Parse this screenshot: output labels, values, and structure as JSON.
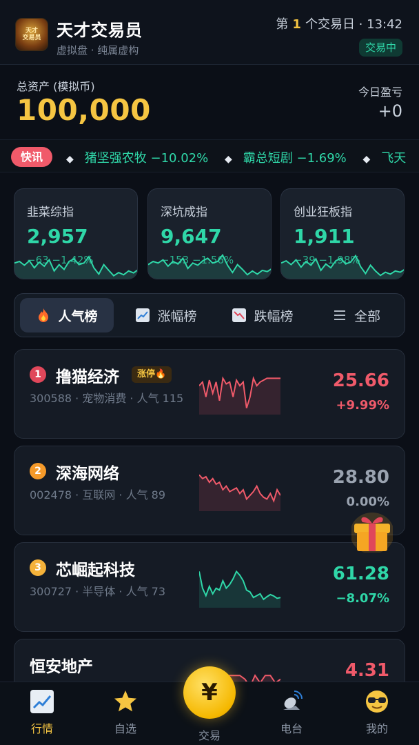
{
  "header": {
    "logo_text": "天才\n交易员",
    "title": "天才交易员",
    "subtitle": "虚拟盘 · 纯属虚构",
    "day_prefix": "第",
    "day_number": "1",
    "day_suffix": "个交易日 · 13:42",
    "status": "交易中"
  },
  "assets": {
    "label": "总资产 (模拟币)",
    "value": "100,000",
    "pnl_label": "今日盈亏",
    "pnl_value": "+0"
  },
  "ticker": {
    "badge": "快讯",
    "items": [
      {
        "name": "猪坚强农牧",
        "change": "−10.02%"
      },
      {
        "name": "霸总短剧",
        "change": "−1.69%"
      },
      {
        "name": "飞天",
        "change": ""
      }
    ]
  },
  "indices": [
    {
      "name": "韭菜综指",
      "value": "2,957",
      "change": "−63 −1.42%",
      "trend": [
        0.55,
        0.5,
        0.62,
        0.48,
        0.7,
        0.52,
        0.65,
        0.45,
        0.8,
        0.6,
        0.75,
        0.5,
        0.42,
        0.6,
        0.55,
        0.35,
        0.7,
        0.9,
        0.6,
        0.78,
        0.95,
        0.85,
        0.92,
        0.8,
        0.86,
        0.75
      ]
    },
    {
      "name": "深坑成指",
      "value": "9,647",
      "change": "−153 −1.56%",
      "trend": [
        0.6,
        0.5,
        0.55,
        0.45,
        0.65,
        0.5,
        0.58,
        0.4,
        0.72,
        0.55,
        0.62,
        0.48,
        0.4,
        0.55,
        0.5,
        0.3,
        0.62,
        0.85,
        0.6,
        0.75,
        0.92,
        0.8,
        0.9,
        0.78,
        0.82,
        0.72
      ]
    },
    {
      "name": "创业狂板指",
      "value": "1,911",
      "change": "−39 −1.98%",
      "trend": [
        0.55,
        0.48,
        0.6,
        0.45,
        0.68,
        0.5,
        0.62,
        0.42,
        0.78,
        0.58,
        0.7,
        0.48,
        0.4,
        0.58,
        0.52,
        0.32,
        0.66,
        0.88,
        0.62,
        0.8,
        0.94,
        0.84,
        0.9,
        0.8,
        0.84,
        0.74
      ]
    }
  ],
  "tabs": [
    {
      "label": "人气榜",
      "icon": "fire-icon",
      "active": true
    },
    {
      "label": "涨幅榜",
      "icon": "chart-up-icon",
      "active": false
    },
    {
      "label": "跌幅榜",
      "icon": "chart-down-icon",
      "active": false
    },
    {
      "label": "全部",
      "icon": "menu-icon",
      "active": false
    }
  ],
  "stocks": [
    {
      "rank": "1",
      "name": "撸猫经济",
      "badge": "涨停🔥",
      "meta": "300588 · 宠物消费 · 人气 115",
      "price": "25.66",
      "change": "+9.99%",
      "color": "#f05a6a",
      "trend": [
        0.3,
        0.2,
        0.6,
        0.15,
        0.5,
        0.2,
        0.7,
        0.1,
        0.25,
        0.2,
        0.6,
        0.15,
        0.3,
        0.2,
        0.9,
        0.6,
        0.1,
        0.3,
        0.2,
        0.15,
        0.1,
        0.1,
        0.1,
        0.1,
        0.1
      ]
    },
    {
      "rank": "2",
      "name": "深海网络",
      "badge": "",
      "meta": "002478 · 互联网 · 人气 89",
      "price": "28.80",
      "change": "0.00%",
      "color": "#8a94a3",
      "trend": [
        0.1,
        0.2,
        0.15,
        0.3,
        0.2,
        0.35,
        0.3,
        0.5,
        0.4,
        0.55,
        0.5,
        0.45,
        0.6,
        0.5,
        0.75,
        0.65,
        0.55,
        0.4,
        0.6,
        0.7,
        0.75,
        0.6,
        0.8,
        0.5,
        0.65
      ]
    },
    {
      "rank": "3",
      "name": "芯崛起科技",
      "badge": "",
      "meta": "300727 · 半导体 · 人气 73",
      "price": "61.28",
      "change": "−8.07%",
      "color": "#2fd7a8",
      "trend": [
        0.1,
        0.55,
        0.75,
        0.5,
        0.7,
        0.55,
        0.6,
        0.35,
        0.55,
        0.45,
        0.3,
        0.1,
        0.2,
        0.35,
        0.6,
        0.65,
        0.8,
        0.75,
        0.7,
        0.85,
        0.78,
        0.72,
        0.76,
        0.82,
        0.8
      ]
    },
    {
      "rank": "",
      "name": "恒安地产",
      "badge": "",
      "meta": "",
      "price": "4.31",
      "change": "",
      "color": "#f05a6a",
      "trend": [
        0.5,
        0.3,
        0.3,
        0.5,
        0.3,
        0.6,
        0.3,
        0.3,
        0.3,
        0.4,
        0.6,
        0.3,
        0.5,
        0.3,
        0.3,
        0.5,
        0.4
      ]
    }
  ],
  "nav": {
    "market": "行情",
    "watchlist": "自选",
    "trade": "交易",
    "trade_symbol": "¥",
    "radio": "电台",
    "mine": "我的"
  }
}
